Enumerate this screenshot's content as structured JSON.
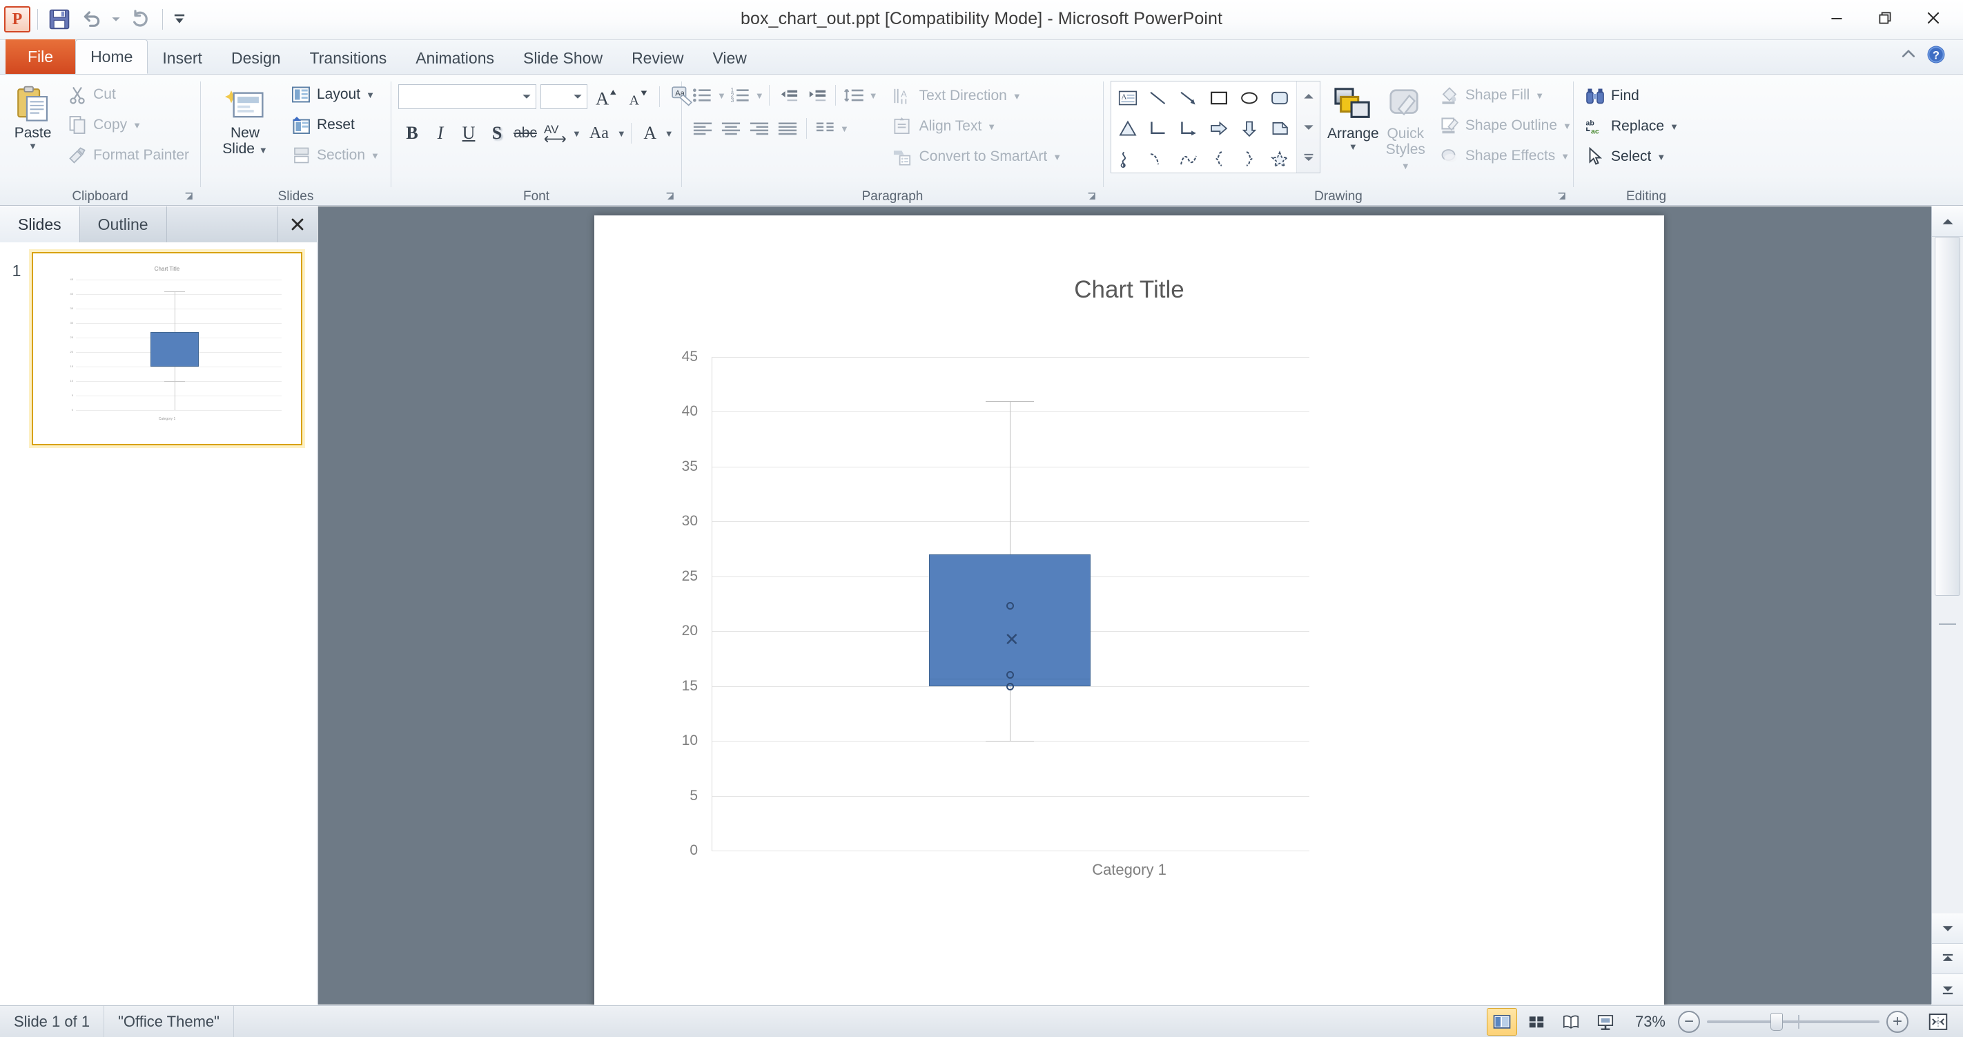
{
  "window": {
    "title": "box_chart_out.ppt [Compatibility Mode]  -  Microsoft PowerPoint",
    "minimize_label": "Minimize",
    "restore_label": "Restore Down",
    "close_label": "Close"
  },
  "quick_access": {
    "app_icon": "powerpoint-icon",
    "save_label": "Save",
    "undo_label": "Undo",
    "redo_label": "Repeat",
    "customize_label": "Customize Quick Access Toolbar"
  },
  "ribbon": {
    "file_tab": "File",
    "tabs": [
      {
        "label": "Home",
        "active": true
      },
      {
        "label": "Insert",
        "active": false
      },
      {
        "label": "Design",
        "active": false
      },
      {
        "label": "Transitions",
        "active": false
      },
      {
        "label": "Animations",
        "active": false
      },
      {
        "label": "Slide Show",
        "active": false
      },
      {
        "label": "Review",
        "active": false
      },
      {
        "label": "View",
        "active": false
      }
    ],
    "minimize_ribbon_label": "Minimize the Ribbon",
    "help_label": "Microsoft PowerPoint Help",
    "groups": {
      "clipboard": {
        "label": "Clipboard",
        "paste_label": "Paste",
        "cut_label": "Cut",
        "copy_label": "Copy",
        "format_painter_label": "Format Painter"
      },
      "slides": {
        "label": "Slides",
        "new_slide_line1": "New",
        "new_slide_line2": "Slide",
        "layout_label": "Layout",
        "reset_label": "Reset",
        "section_label": "Section"
      },
      "font": {
        "label": "Font",
        "font_name_value": "",
        "font_name_placeholder": "",
        "font_size_value": "",
        "font_size_placeholder": "",
        "grow_font_label": "Increase Font Size",
        "shrink_font_label": "Decrease Font Size",
        "clear_formatting_label": "Clear All Formatting",
        "bold_label": "B",
        "italic_label": "I",
        "underline_label": "U",
        "shadow_label": "S",
        "strikethrough_label": "abc",
        "spacing_label": "AV",
        "change_case_label": "Aa",
        "font_color_label": "A"
      },
      "paragraph": {
        "label": "Paragraph",
        "bullets_label": "Bullets",
        "numbering_label": "Numbering",
        "decrease_indent_label": "Decrease List Level",
        "increase_indent_label": "Increase List Level",
        "line_spacing_label": "Line Spacing",
        "text_direction_label": "Text Direction",
        "align_text_label": "Align Text",
        "convert_smartart_label": "Convert to SmartArt",
        "align_left_label": "Align Text Left",
        "align_center_label": "Center",
        "align_right_label": "Align Text Right",
        "justify_label": "Justify",
        "columns_label": "Columns"
      },
      "drawing": {
        "label": "Drawing",
        "arrange_label": "Arrange",
        "quick_styles_line1": "Quick",
        "quick_styles_line2": "Styles",
        "shape_fill_label": "Shape Fill",
        "shape_outline_label": "Shape Outline",
        "shape_effects_label": "Shape Effects",
        "shapes": [
          "text-box-icon",
          "line-icon",
          "arrow-icon",
          "rectangle-icon",
          "oval-icon",
          "rounded-rectangle-icon",
          "triangle-icon",
          "elbow-connector-icon",
          "elbow-arrow-connector-icon",
          "right-arrow-icon",
          "down-arrow-icon",
          "flowchart-shape-icon",
          "scribble-icon",
          "curve-icon",
          "freeform-icon",
          "left-brace-icon",
          "right-brace-icon",
          "star-icon"
        ],
        "scroll_up_label": "Scroll Up",
        "scroll_down_label": "Scroll Down",
        "more_label": "More"
      },
      "editing": {
        "label": "Editing",
        "find_label": "Find",
        "replace_label": "Replace",
        "select_label": "Select"
      }
    }
  },
  "left_pane": {
    "tabs": [
      {
        "label": "Slides",
        "active": true
      },
      {
        "label": "Outline",
        "active": false
      }
    ],
    "close_label": "Close",
    "slide_number": "1"
  },
  "status_bar": {
    "slide_counter": "Slide 1 of 1",
    "theme_name": "\"Office Theme\"",
    "zoom_percent": "73%",
    "views": [
      {
        "name": "normal-view-button",
        "active": true
      },
      {
        "name": "slide-sorter-view-button",
        "active": false
      },
      {
        "name": "reading-view-button",
        "active": false
      },
      {
        "name": "slide-show-button",
        "active": false
      }
    ],
    "zoom_out_label": "−",
    "zoom_in_label": "+",
    "fit_slide_label": "Fit slide to current window"
  },
  "chart_data": {
    "type": "box",
    "title": "Chart Title",
    "xlabel": "",
    "ylabel": "",
    "categories": [
      "Category 1"
    ],
    "ylim": [
      0,
      45
    ],
    "yticks": [
      0,
      5,
      10,
      15,
      20,
      25,
      30,
      35,
      40,
      45
    ],
    "grid": true,
    "legend": false,
    "box_color": "#5580bc",
    "box_border_color": "#3f6694",
    "whisker_color": "#bfbfbf",
    "marker_color": "#2f4b75",
    "series": [
      {
        "name": "Category 1",
        "whisker_low": 10,
        "q1": 15,
        "median": 15.7,
        "q3": 27,
        "whisker_high": 41,
        "mean": 20,
        "outliers": [
          23,
          15.7,
          15
        ]
      }
    ]
  }
}
